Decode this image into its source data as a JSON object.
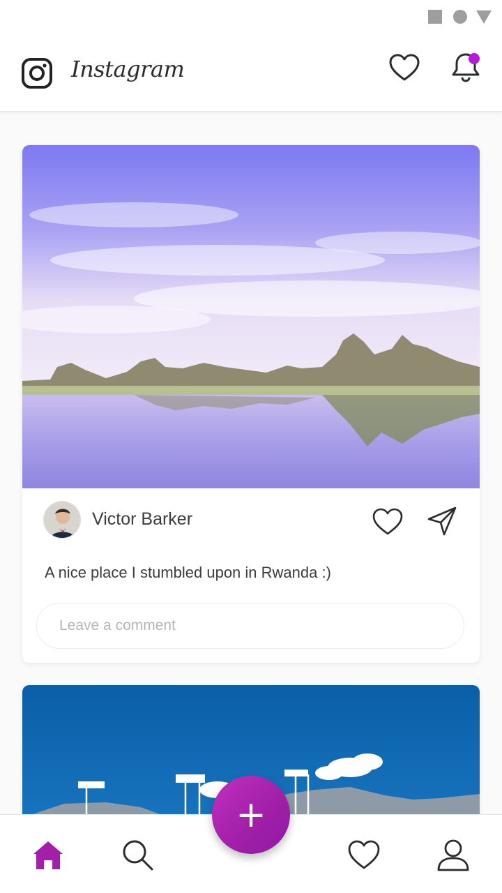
{
  "app": {
    "name": "Instagram",
    "accent_color": "#b51bd6",
    "notification_dot_color": "#b51bd6"
  },
  "status_bar": {
    "icons": [
      "stop-square-icon",
      "circle-icon",
      "triangle-icon"
    ]
  },
  "header": {
    "logo_icon": "instagram-camera-icon",
    "title": "Instagram",
    "actions": [
      "heart-icon",
      "bell-icon"
    ],
    "has_notification": true
  },
  "posts": [
    {
      "image": "lake-with-rock-formations-and-purple-sky",
      "author": "Victor Barker",
      "avatar": "man-with-bow-tie-avatar",
      "caption": "A nice place I stumbled upon in Rwanda :)",
      "comment_placeholder": "Leave a comment",
      "actions": [
        "heart-icon",
        "send-icon"
      ]
    },
    {
      "image": "blue-sky-with-stadium-lights-and-mountains"
    }
  ],
  "fab": {
    "label": "+",
    "icon": "plus-icon",
    "color": "#a01fa6"
  },
  "bottom_nav": {
    "items": [
      {
        "icon": "home-icon",
        "active": true
      },
      {
        "icon": "search-icon",
        "active": false
      },
      {
        "icon": "heart-icon",
        "active": false
      },
      {
        "icon": "profile-icon",
        "active": false
      }
    ]
  }
}
